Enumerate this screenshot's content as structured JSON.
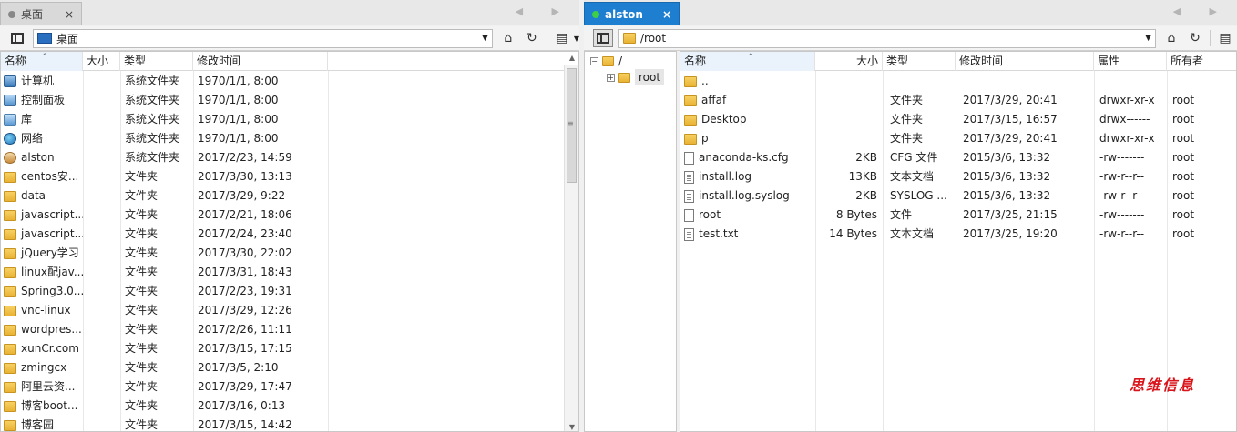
{
  "left_tab": {
    "label": "桌面",
    "close": "×"
  },
  "right_tab": {
    "label": "alston",
    "close": "×"
  },
  "nav_arrows": "◀ ▶",
  "left_toolbar": {
    "path": "桌面"
  },
  "right_toolbar": {
    "path": "/root"
  },
  "left_columns": {
    "name": "名称",
    "size": "大小",
    "type": "类型",
    "modified": "修改时间"
  },
  "left_rows": [
    {
      "icon": "pc",
      "name": "计算机",
      "size": "",
      "type": "系统文件夹",
      "modified": "1970/1/1, 8:00"
    },
    {
      "icon": "cp",
      "name": "控制面板",
      "size": "",
      "type": "系统文件夹",
      "modified": "1970/1/1, 8:00"
    },
    {
      "icon": "lib",
      "name": "库",
      "size": "",
      "type": "系统文件夹",
      "modified": "1970/1/1, 8:00"
    },
    {
      "icon": "net",
      "name": "网络",
      "size": "",
      "type": "系统文件夹",
      "modified": "1970/1/1, 8:00"
    },
    {
      "icon": "user",
      "name": "alston",
      "size": "",
      "type": "系统文件夹",
      "modified": "2017/2/23, 14:59"
    },
    {
      "icon": "folder",
      "name": "centos安...",
      "size": "",
      "type": "文件夹",
      "modified": "2017/3/30, 13:13"
    },
    {
      "icon": "folder",
      "name": "data",
      "size": "",
      "type": "文件夹",
      "modified": "2017/3/29, 9:22"
    },
    {
      "icon": "folder",
      "name": "javascript...",
      "size": "",
      "type": "文件夹",
      "modified": "2017/2/21, 18:06"
    },
    {
      "icon": "folder",
      "name": "javascript...",
      "size": "",
      "type": "文件夹",
      "modified": "2017/2/24, 23:40"
    },
    {
      "icon": "folder",
      "name": "jQuery学习",
      "size": "",
      "type": "文件夹",
      "modified": "2017/3/30, 22:02"
    },
    {
      "icon": "folder",
      "name": "linux配jav...",
      "size": "",
      "type": "文件夹",
      "modified": "2017/3/31, 18:43"
    },
    {
      "icon": "folder",
      "name": "Spring3.0...",
      "size": "",
      "type": "文件夹",
      "modified": "2017/2/23, 19:31"
    },
    {
      "icon": "folder",
      "name": "vnc-linux",
      "size": "",
      "type": "文件夹",
      "modified": "2017/3/29, 12:26"
    },
    {
      "icon": "folder",
      "name": "wordpres...",
      "size": "",
      "type": "文件夹",
      "modified": "2017/2/26, 11:11"
    },
    {
      "icon": "folder",
      "name": "xunCr.com",
      "size": "",
      "type": "文件夹",
      "modified": "2017/3/15, 17:15"
    },
    {
      "icon": "folder",
      "name": "zmingcx",
      "size": "",
      "type": "文件夹",
      "modified": "2017/3/5, 2:10"
    },
    {
      "icon": "folder",
      "name": "阿里云资...",
      "size": "",
      "type": "文件夹",
      "modified": "2017/3/29, 17:47"
    },
    {
      "icon": "folder",
      "name": "博客boot...",
      "size": "",
      "type": "文件夹",
      "modified": "2017/3/16, 0:13"
    },
    {
      "icon": "folder",
      "name": "博客园",
      "size": "",
      "type": "文件夹",
      "modified": "2017/3/15, 14:42"
    }
  ],
  "tree": {
    "root": "/",
    "child": "root"
  },
  "right_columns": {
    "name": "名称",
    "size": "大小",
    "type": "类型",
    "modified": "修改时间",
    "perm": "属性",
    "owner": "所有者"
  },
  "right_rows": [
    {
      "icon": "folder",
      "name": "..",
      "size": "",
      "type": "",
      "modified": "",
      "perm": "",
      "owner": ""
    },
    {
      "icon": "folder",
      "name": "affaf",
      "size": "",
      "type": "文件夹",
      "modified": "2017/3/29, 20:41",
      "perm": "drwxr-xr-x",
      "owner": "root"
    },
    {
      "icon": "folder",
      "name": "Desktop",
      "size": "",
      "type": "文件夹",
      "modified": "2017/3/15, 16:57",
      "perm": "drwx------",
      "owner": "root"
    },
    {
      "icon": "folder",
      "name": "p",
      "size": "",
      "type": "文件夹",
      "modified": "2017/3/29, 20:41",
      "perm": "drwxr-xr-x",
      "owner": "root"
    },
    {
      "icon": "file",
      "name": "anaconda-ks.cfg",
      "size": "2KB",
      "type": "CFG 文件",
      "modified": "2015/3/6, 13:32",
      "perm": "-rw-------",
      "owner": "root"
    },
    {
      "icon": "txt",
      "name": "install.log",
      "size": "13KB",
      "type": "文本文档",
      "modified": "2015/3/6, 13:32",
      "perm": "-rw-r--r--",
      "owner": "root"
    },
    {
      "icon": "txt",
      "name": "install.log.syslog",
      "size": "2KB",
      "type": "SYSLOG ...",
      "modified": "2015/3/6, 13:32",
      "perm": "-rw-r--r--",
      "owner": "root"
    },
    {
      "icon": "file",
      "name": "root",
      "size": "8 Bytes",
      "type": "文件",
      "modified": "2017/3/25, 21:15",
      "perm": "-rw-------",
      "owner": "root"
    },
    {
      "icon": "txt",
      "name": "test.txt",
      "size": "14 Bytes",
      "type": "文本文档",
      "modified": "2017/3/25, 19:20",
      "perm": "-rw-r--r--",
      "owner": "root"
    }
  ],
  "watermark": "思维信息"
}
